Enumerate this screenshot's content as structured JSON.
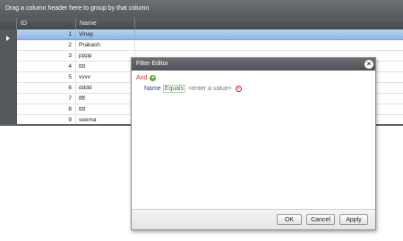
{
  "group_panel": {
    "text": "Drag a column header here to group by that column"
  },
  "columns": [
    "ID",
    "Name"
  ],
  "rows": [
    {
      "id": "1",
      "name": "Vinay",
      "selected": true
    },
    {
      "id": "2",
      "name": "Prakash"
    },
    {
      "id": "3",
      "name": "pppp"
    },
    {
      "id": "4",
      "name": "tttt"
    },
    {
      "id": "5",
      "name": "vvvv"
    },
    {
      "id": "6",
      "name": "dddd"
    },
    {
      "id": "7",
      "name": "ffff"
    },
    {
      "id": "8",
      "name": "tttt"
    },
    {
      "id": "9",
      "name": "seema"
    }
  ],
  "filter_editor": {
    "title": "Filter Editor",
    "close_icon": "×",
    "group_operator": "And",
    "add_icon": "+",
    "condition": {
      "field": "Name",
      "operator": "Equals",
      "value_placeholder": "<enter a value>"
    },
    "remove_icon": "×",
    "buttons": {
      "ok": "OK",
      "cancel": "Cancel",
      "apply": "Apply"
    }
  },
  "colors": {
    "header_dark": "#4e5155",
    "selection": "#8fb6e6",
    "and_red": "#c0392b",
    "field_blue": "#1f3fa0",
    "operator_green": "#2e7d32"
  }
}
